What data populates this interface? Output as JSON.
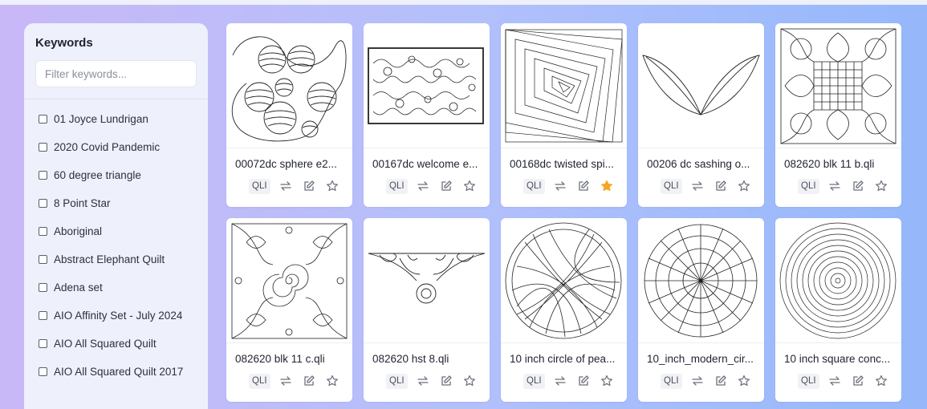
{
  "sidebar": {
    "title": "Keywords",
    "filter_placeholder": "Filter keywords...",
    "keywords": [
      "01 Joyce Lundrigan",
      "2020 Covid Pandemic",
      "60 degree triangle",
      "8 Point Star",
      "Aboriginal",
      "Abstract Elephant Quilt",
      "Adena set",
      "AIO Affinity Set - July 2024",
      "AIO All Squared Quilt",
      "AIO All Squared Quilt 2017"
    ]
  },
  "colors": {
    "favorite_active": "#f5a623",
    "icon_gray": "#6b6f7b"
  },
  "cards": [
    {
      "name": "00072dc sphere e2...",
      "badge": "QLI",
      "favorite": false,
      "thumb": "spheres-icon"
    },
    {
      "name": "00167dc welcome e...",
      "badge": "QLI",
      "favorite": false,
      "thumb": "welcome-pattern-icon"
    },
    {
      "name": "00168dc twisted spi...",
      "badge": "QLI",
      "favorite": true,
      "thumb": "twisted-spiral-icon"
    },
    {
      "name": "00206 dc sashing o...",
      "badge": "QLI",
      "favorite": false,
      "thumb": "sashing-leaves-icon"
    },
    {
      "name": "082620 blk 11 b.qli",
      "badge": "QLI",
      "favorite": false,
      "thumb": "block-grid-icon"
    },
    {
      "name": "082620 blk 11 c.qli",
      "badge": "QLI",
      "favorite": false,
      "thumb": "block-swirl-icon"
    },
    {
      "name": "082620 hst 8.qli",
      "badge": "QLI",
      "favorite": false,
      "thumb": "hst-border-icon"
    },
    {
      "name": "10 inch circle of pea...",
      "badge": "QLI",
      "favorite": false,
      "thumb": "circle-pearls-icon"
    },
    {
      "name": "10_inch_modern_cir...",
      "badge": "QLI",
      "favorite": false,
      "thumb": "modern-circle-icon"
    },
    {
      "name": "10 inch square conc...",
      "badge": "QLI",
      "favorite": false,
      "thumb": "concentric-icon"
    }
  ]
}
